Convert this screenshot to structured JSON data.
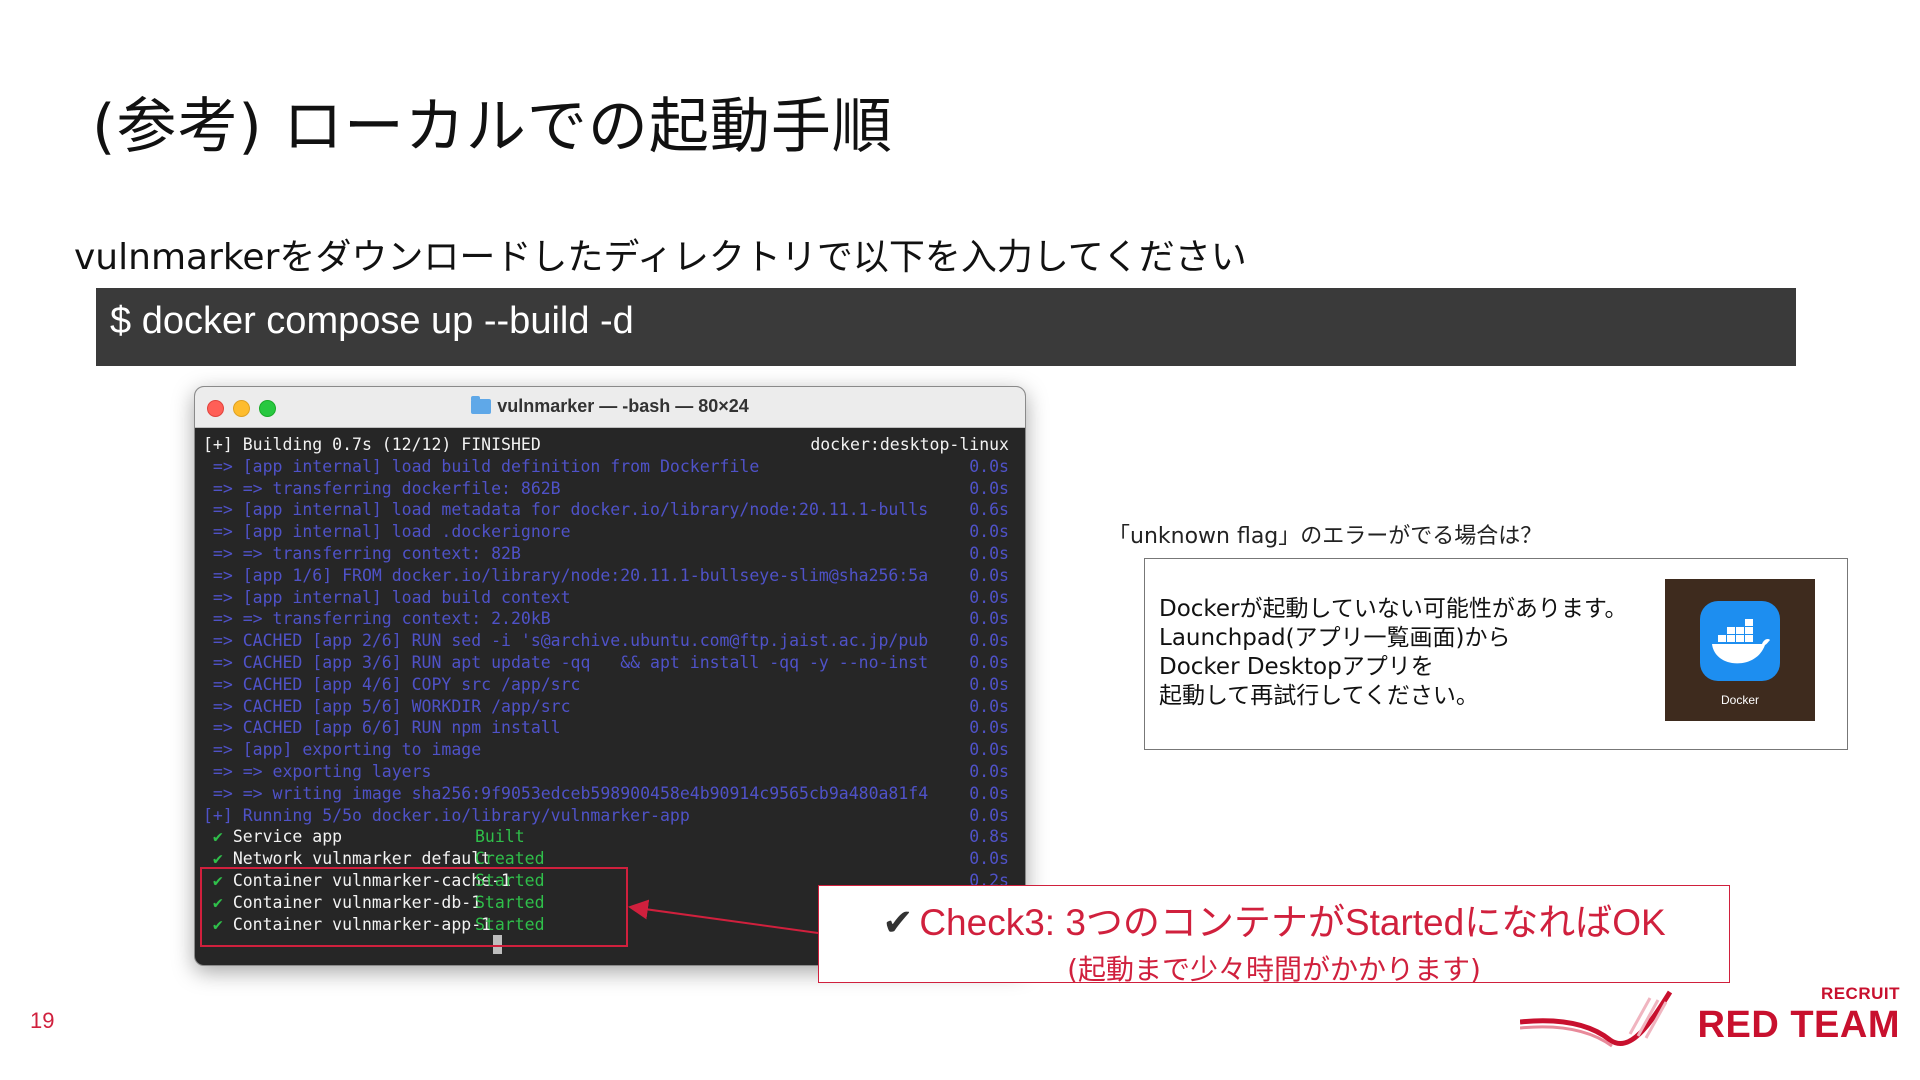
{
  "slide": {
    "title": "(参考) ローカルでの起動手順",
    "instruction": "vulnmarkerをダウンロードしたディレクトリで以下を入力してください",
    "command": "$ docker compose up --build -d",
    "page_number": "19"
  },
  "terminal": {
    "window_title": "vulnmarker — -bash — 80×24",
    "lines": [
      {
        "left": "[+] Building 0.7s (12/12) FINISHED",
        "right": "docker:desktop-linux",
        "color": "white",
        "check": false
      },
      {
        "left": " => [app internal] load build definition from Dockerfile",
        "right": "0.0s",
        "color": "blue",
        "check": false
      },
      {
        "left": " => => transferring dockerfile: 862B",
        "right": "0.0s",
        "color": "blue",
        "check": false
      },
      {
        "left": " => [app internal] load metadata for docker.io/library/node:20.11.1-bulls",
        "right": "0.6s",
        "color": "blue",
        "check": false
      },
      {
        "left": " => [app internal] load .dockerignore",
        "right": "0.0s",
        "color": "blue",
        "check": false
      },
      {
        "left": " => => transferring context: 82B",
        "right": "0.0s",
        "color": "blue",
        "check": false
      },
      {
        "left": " => [app 1/6] FROM docker.io/library/node:20.11.1-bullseye-slim@sha256:5a",
        "right": "0.0s",
        "color": "blue",
        "check": false
      },
      {
        "left": " => [app internal] load build context",
        "right": "0.0s",
        "color": "blue",
        "check": false
      },
      {
        "left": " => => transferring context: 2.20kB",
        "right": "0.0s",
        "color": "blue",
        "check": false
      },
      {
        "left": " => CACHED [app 2/6] RUN sed -i 's@archive.ubuntu.com@ftp.jaist.ac.jp/pub",
        "right": "0.0s",
        "color": "blue",
        "check": false
      },
      {
        "left": " => CACHED [app 3/6] RUN apt update -qq   && apt install -qq -y --no-inst",
        "right": "0.0s",
        "color": "blue",
        "check": false
      },
      {
        "left": " => CACHED [app 4/6] COPY src /app/src",
        "right": "0.0s",
        "color": "blue",
        "check": false
      },
      {
        "left": " => CACHED [app 5/6] WORKDIR /app/src",
        "right": "0.0s",
        "color": "blue",
        "check": false
      },
      {
        "left": " => CACHED [app 6/6] RUN npm install",
        "right": "0.0s",
        "color": "blue",
        "check": false
      },
      {
        "left": " => [app] exporting to image",
        "right": "0.0s",
        "color": "blue",
        "check": false
      },
      {
        "left": " => => exporting layers",
        "right": "0.0s",
        "color": "blue",
        "check": false
      },
      {
        "left": " => => writing image sha256:9f9053edceb598900458e4b90914c9565cb9a480a81f4",
        "right": "0.0s",
        "color": "blue",
        "check": false
      },
      {
        "left": "[+] Running 5/5o docker.io/library/vulnmarker-app",
        "right": "0.0s",
        "color": "blue",
        "check": false
      },
      {
        "left": "Service app",
        "status": "Built",
        "right": "0.8s",
        "color": "white",
        "check": true
      },
      {
        "left": "Network vulnmarker_default",
        "status": "Created",
        "right": "0.0s",
        "color": "white",
        "check": true
      },
      {
        "left": "Container vulnmarker-cache-1",
        "status": "Started",
        "right": "0.2s",
        "color": "white",
        "check": true
      },
      {
        "left": "Container vulnmarker-db-1",
        "status": "Started",
        "right": "",
        "color": "white",
        "check": true
      },
      {
        "left": "Container vulnmarker-app-1",
        "status": "Started",
        "right": "",
        "color": "white",
        "check": true
      }
    ],
    "colors": {
      "white": "#f2f2f2",
      "blue": "#4f52c8",
      "green": "#2fbf4a"
    }
  },
  "callout": {
    "check_mark": "✔",
    "line1": "Check3: 3つのコンテナがStartedになればOK",
    "line2": "(起動まで少々時間がかかります)"
  },
  "unknown_flag": {
    "heading": "「unknown flag」のエラーがでる場合は？",
    "body": [
      "Dockerが起動していない可能性があります。",
      "Launchpad(アプリ一覧画面)から",
      "Docker Desktopアプリを",
      "起動して再試行してください。"
    ],
    "app_label": "Docker",
    "icon": "docker-whale-icon"
  },
  "logo": {
    "top": "RECRUIT",
    "main": "RED TEAM"
  },
  "accent_color": "#d0203d"
}
